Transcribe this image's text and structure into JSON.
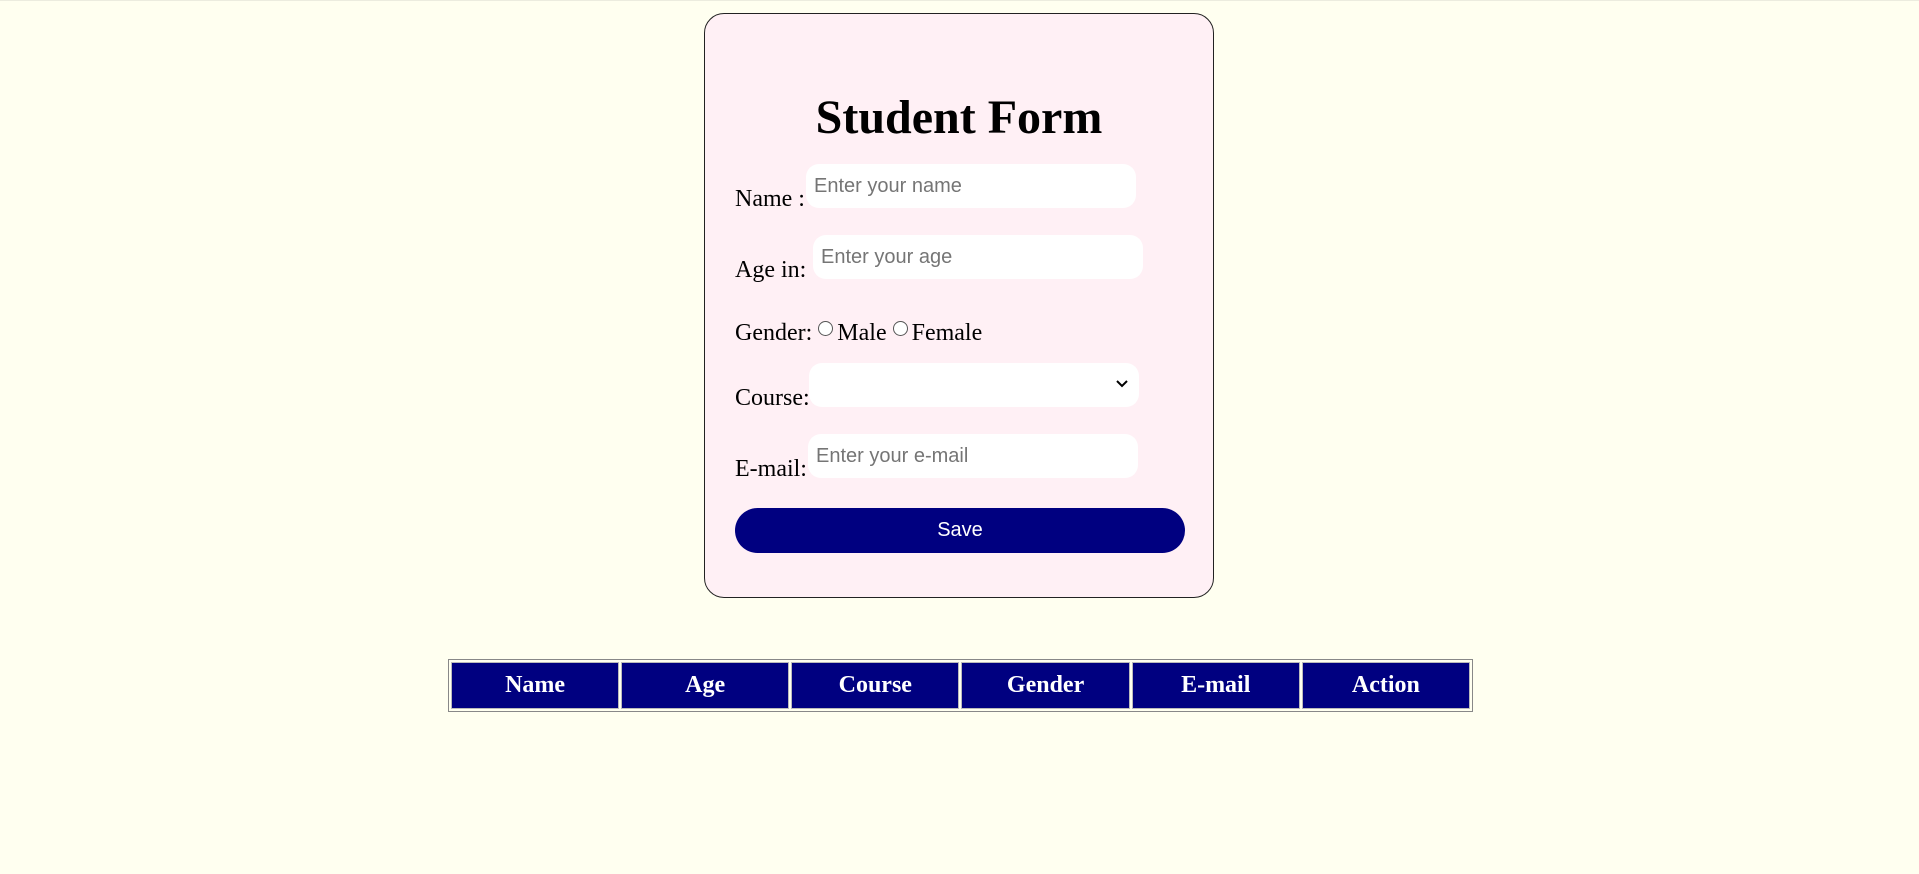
{
  "form": {
    "title": "Student Form",
    "name_label": "Name :",
    "name_placeholder": "Enter your name",
    "age_label": "Age in:",
    "age_placeholder": "Enter your age",
    "gender_label": "Gender:",
    "gender_options": [
      "Male",
      "Female"
    ],
    "course_label": "Course:",
    "course_selected": "",
    "email_label": "E-mail:",
    "email_placeholder": "Enter your e-mail",
    "save_label": "Save"
  },
  "table": {
    "headers": [
      "Name",
      "Age",
      "Course",
      "Gender",
      "E-mail",
      "Action"
    ],
    "rows": []
  },
  "colors": {
    "page_bg": "#fffff0",
    "card_bg": "#fff0f5",
    "accent": "#000080"
  }
}
